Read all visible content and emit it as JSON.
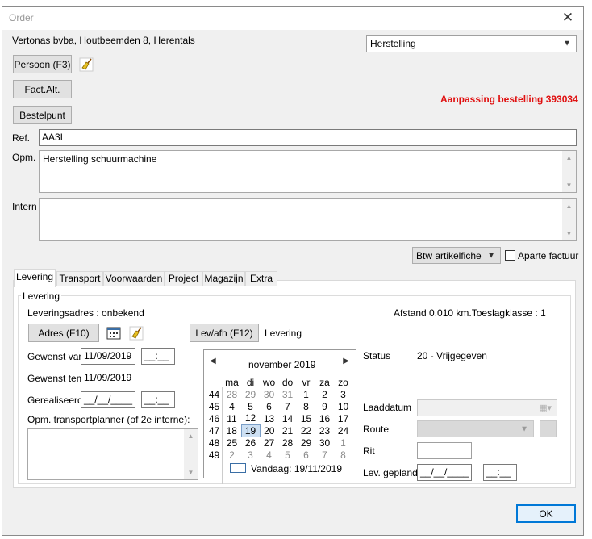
{
  "window": {
    "title": "Order",
    "close_label": "✕"
  },
  "header": {
    "customer": "Vertonas bvba, Houtbeemden 8, Herentals",
    "order_type": "Herstelling",
    "status_message": "Aanpassing bestelling 393034"
  },
  "buttons": {
    "persoon": "Persoon (F3)",
    "fact_alt": "Fact.Alt.",
    "bestelpunt": "Bestelpunt",
    "adres": "Adres (F10)",
    "lev_afh": "Lev/afh (F12)",
    "ok": "OK"
  },
  "fields": {
    "ref_label": "Ref.",
    "ref_value": "AA3I",
    "opm_label": "Opm.",
    "opm_value": "Herstelling schuurmachine",
    "intern_label": "Intern",
    "intern_value": "",
    "btw_value": "Btw artikelfiche",
    "aparte_factuur_label": "Aparte factuur"
  },
  "tabs": [
    {
      "label": "Levering"
    },
    {
      "label": "Transport"
    },
    {
      "label": "Voorwaarden"
    },
    {
      "label": "Project"
    },
    {
      "label": "Magazijn"
    },
    {
      "label": "Extra"
    }
  ],
  "levering": {
    "group_label": "Levering",
    "leveringsadres": "Leveringsadres : onbekend",
    "afstand": "Afstand 0.010 km.Toeslagklasse : 1",
    "lev_mode": "Levering",
    "gewenst_van_label": "Gewenst van",
    "gewenst_van_date": "11/09/2019",
    "gewenst_van_time": "__:__",
    "gewenst_tem_label": "Gewenst tem",
    "gewenst_tem_date": "11/09/2019",
    "gerealiseerd_label": "Gerealiseerd",
    "gerealiseerd_date": "__/__/____",
    "gerealiseerd_time": "__:__",
    "opm_transport_label": "Opm. transportplanner (of 2e interne):",
    "status_label": "Status",
    "status_value": "20 - Vrijgegeven",
    "laaddatum_label": "Laaddatum",
    "route_label": "Route",
    "rit_label": "Rit",
    "lev_gepland_label": "Lev. gepland",
    "lev_gepland_date": "__/__/____",
    "lev_gepland_time": "__:__"
  },
  "calendar": {
    "month_label": "november 2019",
    "day_headers": [
      "ma",
      "di",
      "wo",
      "do",
      "vr",
      "za",
      "zo"
    ],
    "weeks": [
      {
        "wk": "44",
        "days": [
          "28",
          "29",
          "30",
          "31",
          "1",
          "2",
          "3"
        ]
      },
      {
        "wk": "45",
        "days": [
          "4",
          "5",
          "6",
          "7",
          "8",
          "9",
          "10"
        ]
      },
      {
        "wk": "46",
        "days": [
          "11",
          "12",
          "13",
          "14",
          "15",
          "16",
          "17"
        ]
      },
      {
        "wk": "47",
        "days": [
          "18",
          "19",
          "20",
          "21",
          "22",
          "23",
          "24"
        ]
      },
      {
        "wk": "48",
        "days": [
          "25",
          "26",
          "27",
          "28",
          "29",
          "30",
          "1"
        ]
      },
      {
        "wk": "49",
        "days": [
          "2",
          "3",
          "4",
          "5",
          "6",
          "7",
          "8"
        ]
      }
    ],
    "selected_day": "19",
    "today_label": "Vandaag: 19/11/2019"
  }
}
